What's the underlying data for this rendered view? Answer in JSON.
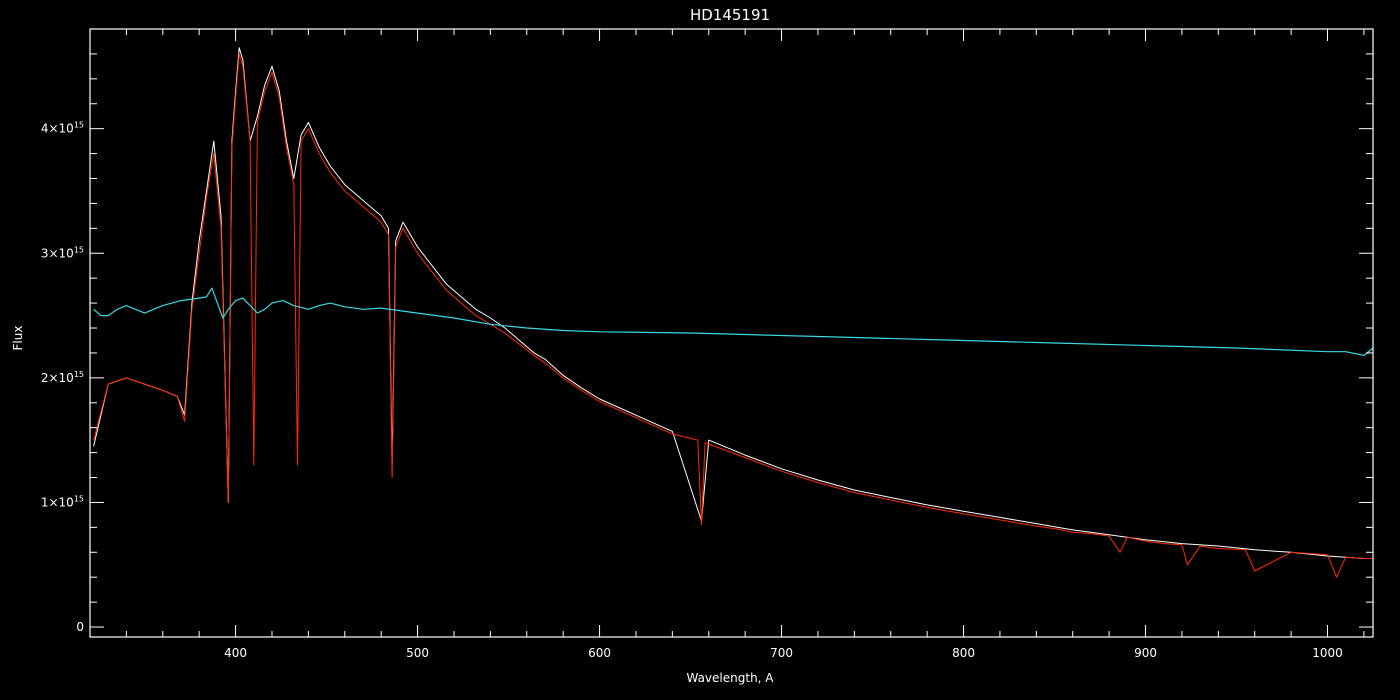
{
  "chart_data": {
    "type": "line",
    "title": "HD145191",
    "xlabel": "Wavelength, A",
    "ylabel": "Flux",
    "xlim": [
      320,
      1025
    ],
    "ylim": [
      -0.08,
      4.8
    ],
    "y_exponent": "15",
    "x_ticks": [
      {
        "value": 400,
        "label": "400"
      },
      {
        "value": 500,
        "label": "500"
      },
      {
        "value": 600,
        "label": "600"
      },
      {
        "value": 700,
        "label": "700"
      },
      {
        "value": 800,
        "label": "800"
      },
      {
        "value": 900,
        "label": "900"
      },
      {
        "value": 1000,
        "label": "1000"
      }
    ],
    "y_ticks": [
      {
        "value": 0,
        "mantissa": "0",
        "has_exponent": false
      },
      {
        "value": 1,
        "mantissa": "1×10",
        "has_exponent": true
      },
      {
        "value": 2,
        "mantissa": "2×10",
        "has_exponent": true
      },
      {
        "value": 3,
        "mantissa": "3×10",
        "has_exponent": true
      },
      {
        "value": 4,
        "mantissa": "4×10",
        "has_exponent": true
      }
    ],
    "series": [
      {
        "color": "#ffffff",
        "x": [
          322,
          330,
          340,
          350,
          360,
          368,
          372,
          376,
          380,
          384,
          388,
          392,
          396,
          398,
          400,
          402,
          404,
          408,
          412,
          416,
          420,
          424,
          428,
          432,
          436,
          440,
          446,
          452,
          460,
          468,
          476,
          480,
          484,
          486,
          488,
          492,
          500,
          508,
          516,
          524,
          532,
          540,
          548,
          556,
          564,
          570,
          580,
          590,
          600,
          620,
          640,
          656,
          660,
          680,
          700,
          720,
          740,
          760,
          780,
          800,
          820,
          840,
          860,
          880,
          900,
          920,
          940,
          960,
          980,
          1000,
          1020,
          1025
        ],
        "y": [
          1.45,
          1.95,
          2.0,
          1.95,
          1.9,
          1.85,
          1.7,
          2.6,
          3.1,
          3.5,
          3.9,
          3.3,
          1.0,
          3.9,
          4.3,
          4.65,
          4.55,
          3.9,
          4.1,
          4.35,
          4.5,
          4.3,
          3.9,
          3.6,
          3.95,
          4.05,
          3.85,
          3.7,
          3.55,
          3.45,
          3.35,
          3.3,
          3.2,
          1.3,
          3.1,
          3.25,
          3.05,
          2.9,
          2.75,
          2.65,
          2.55,
          2.48,
          2.4,
          2.3,
          2.2,
          2.15,
          2.02,
          1.92,
          1.83,
          1.7,
          1.57,
          0.85,
          1.5,
          1.38,
          1.27,
          1.18,
          1.1,
          1.04,
          0.98,
          0.93,
          0.88,
          0.83,
          0.78,
          0.74,
          0.7,
          0.67,
          0.65,
          0.62,
          0.6,
          0.57,
          0.55,
          0.55
        ]
      },
      {
        "color": "#ff2a00",
        "x": [
          322,
          330,
          340,
          350,
          360,
          368,
          372,
          376,
          380,
          384,
          388,
          392,
          396,
          398,
          400,
          402,
          404,
          408,
          410,
          412,
          416,
          420,
          424,
          428,
          432,
          434,
          436,
          440,
          446,
          452,
          460,
          468,
          476,
          480,
          484,
          486,
          488,
          492,
          500,
          508,
          516,
          524,
          532,
          540,
          548,
          556,
          564,
          570,
          580,
          590,
          600,
          620,
          640,
          654,
          656,
          658,
          680,
          700,
          720,
          740,
          760,
          780,
          800,
          820,
          840,
          850,
          860,
          870,
          880,
          886,
          890,
          900,
          910,
          920,
          923,
          930,
          940,
          955,
          960,
          980,
          1000,
          1005,
          1010,
          1020,
          1025
        ],
        "y": [
          1.5,
          1.95,
          2.0,
          1.95,
          1.9,
          1.85,
          1.65,
          2.55,
          3.0,
          3.45,
          3.8,
          3.2,
          1.0,
          3.85,
          4.25,
          4.6,
          4.5,
          3.9,
          1.3,
          4.05,
          4.3,
          4.45,
          4.25,
          3.85,
          3.55,
          1.3,
          3.9,
          4.0,
          3.8,
          3.65,
          3.5,
          3.4,
          3.3,
          3.25,
          3.15,
          1.2,
          3.05,
          3.2,
          3.0,
          2.85,
          2.7,
          2.6,
          2.5,
          2.43,
          2.36,
          2.27,
          2.18,
          2.12,
          2.0,
          1.9,
          1.81,
          1.68,
          1.55,
          1.5,
          0.82,
          1.48,
          1.36,
          1.25,
          1.16,
          1.08,
          1.02,
          0.96,
          0.91,
          0.86,
          0.81,
          0.79,
          0.76,
          0.75,
          0.73,
          0.6,
          0.72,
          0.69,
          0.67,
          0.66,
          0.5,
          0.65,
          0.63,
          0.62,
          0.45,
          0.6,
          0.58,
          0.4,
          0.56,
          0.55,
          0.55
        ]
      },
      {
        "color": "#39d8e6",
        "x": [
          322,
          326,
          330,
          335,
          340,
          345,
          350,
          355,
          360,
          365,
          370,
          375,
          380,
          384,
          387,
          390,
          393,
          396,
          400,
          404,
          408,
          412,
          416,
          420,
          426,
          432,
          440,
          446,
          452,
          460,
          470,
          480,
          490,
          500,
          520,
          540,
          560,
          580,
          600,
          650,
          700,
          750,
          800,
          850,
          900,
          950,
          1000,
          1010,
          1020,
          1025
        ],
        "y": [
          2.55,
          2.5,
          2.5,
          2.55,
          2.58,
          2.55,
          2.52,
          2.55,
          2.58,
          2.6,
          2.62,
          2.63,
          2.64,
          2.65,
          2.72,
          2.6,
          2.48,
          2.55,
          2.62,
          2.64,
          2.58,
          2.52,
          2.55,
          2.6,
          2.62,
          2.58,
          2.55,
          2.58,
          2.6,
          2.57,
          2.55,
          2.56,
          2.54,
          2.52,
          2.48,
          2.43,
          2.4,
          2.38,
          2.37,
          2.36,
          2.34,
          2.32,
          2.3,
          2.28,
          2.26,
          2.24,
          2.21,
          2.21,
          2.18,
          2.24
        ]
      }
    ]
  }
}
